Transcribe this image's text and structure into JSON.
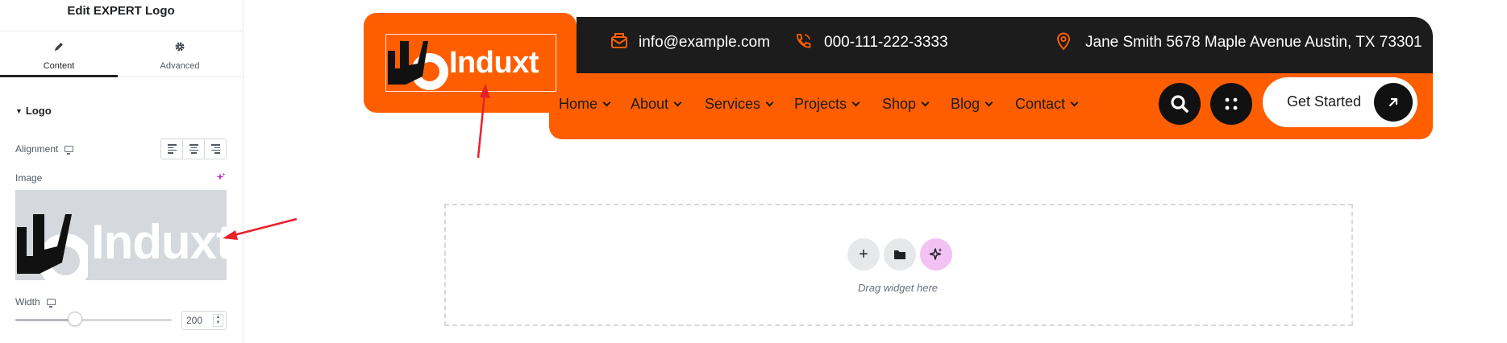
{
  "editor": {
    "title": "Edit EXPERT Logo",
    "tabs": [
      {
        "label": "Content",
        "icon": "pencil-icon",
        "active": true
      },
      {
        "label": "Advanced",
        "icon": "gear-icon",
        "active": false
      }
    ],
    "section": {
      "title": "Logo",
      "expanded": true
    },
    "alignment": {
      "label": "Alignment",
      "options": [
        "left",
        "center",
        "right"
      ]
    },
    "image": {
      "label": "Image",
      "preview_text": "Induxt"
    },
    "width": {
      "label": "Width",
      "value": "200",
      "slider_level": 0.38
    }
  },
  "site": {
    "logo_text": "Induxt",
    "email": "info@example.com",
    "phone": "000-111-222-3333",
    "address": "Jane Smith 5678 Maple Avenue Austin, TX 73301",
    "nav": [
      "Home",
      "About",
      "Services",
      "Projects",
      "Shop",
      "Blog",
      "Contact"
    ],
    "cta_label": "Get Started",
    "colors": {
      "brand": "#ff5e00",
      "dark": "#1c1c1c"
    }
  },
  "dropzone": {
    "text": "Drag widget here",
    "buttons": [
      "add-icon",
      "folder-icon",
      "ai-sparkle-icon"
    ]
  },
  "annotations": {
    "arrow_color": "#e8212a"
  }
}
